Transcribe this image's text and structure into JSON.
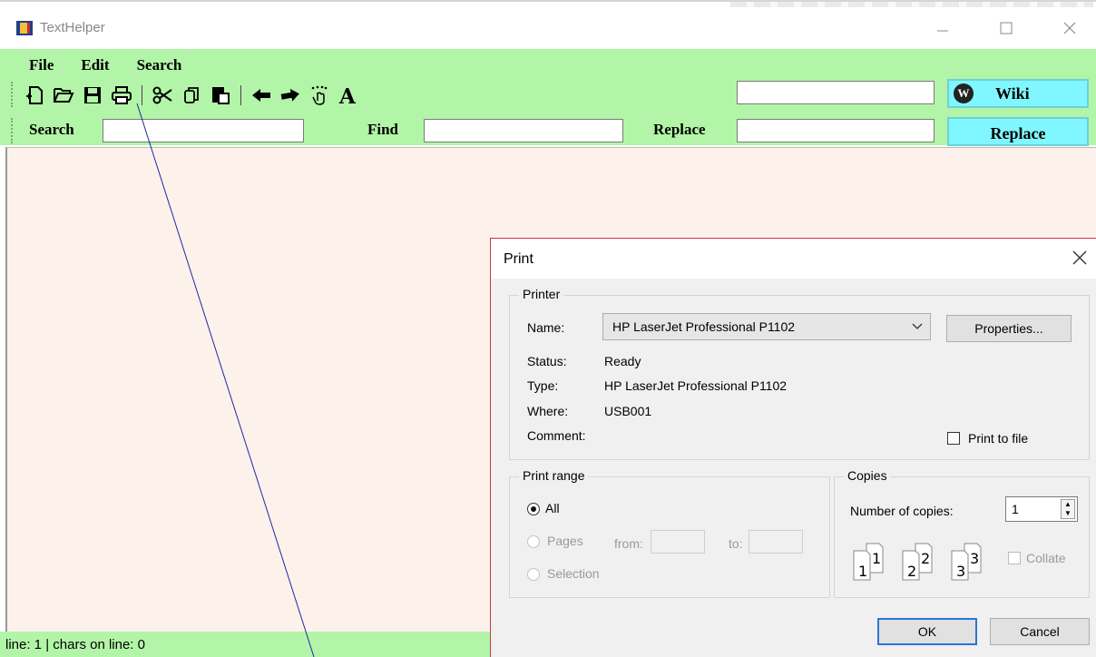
{
  "window": {
    "title": "TextHelper"
  },
  "menu": [
    "File",
    "Edit",
    "Search"
  ],
  "toolbar": {
    "icons": [
      "new-file-icon",
      "open-folder-icon",
      "save-icon",
      "print-icon",
      "cut-icon",
      "copy-icon",
      "paste-icon",
      "undo-icon",
      "redo-icon",
      "touch-icon",
      "font-icon"
    ],
    "wiki_input_value": "",
    "wiki_label": "Wiki"
  },
  "search_row": {
    "search_label": "Search",
    "search_value": "",
    "find_label": "Find",
    "find_value": "",
    "replace_label": "Replace",
    "replace_value": "",
    "replace_button": "Replace"
  },
  "status": {
    "text": "line: 1 | chars on line: 0"
  },
  "print_dialog": {
    "title": "Print",
    "printer_group": "Printer",
    "name_label": "Name:",
    "name_value": "HP LaserJet Professional P1102",
    "properties_button": "Properties...",
    "status_label": "Status:",
    "status_value": "Ready",
    "type_label": "Type:",
    "type_value": "HP LaserJet Professional P1102",
    "where_label": "Where:",
    "where_value": "USB001",
    "comment_label": "Comment:",
    "comment_value": "",
    "print_to_file": "Print to file",
    "range_group": "Print range",
    "range_all": "All",
    "range_pages": "Pages",
    "from_label": "from:",
    "to_label": "to:",
    "range_selection": "Selection",
    "copies_group": "Copies",
    "copies_label": "Number of copies:",
    "copies_value": "1",
    "collate_label": "Collate",
    "ok_button": "OK",
    "cancel_button": "Cancel"
  },
  "colors": {
    "toolbar_green": "#b3f5a8",
    "button_cyan": "#80f6ff",
    "editor_bg": "#fdf1ec",
    "dialog_bg": "#f0f0f0",
    "annotation_line": "#1a2aa0"
  }
}
